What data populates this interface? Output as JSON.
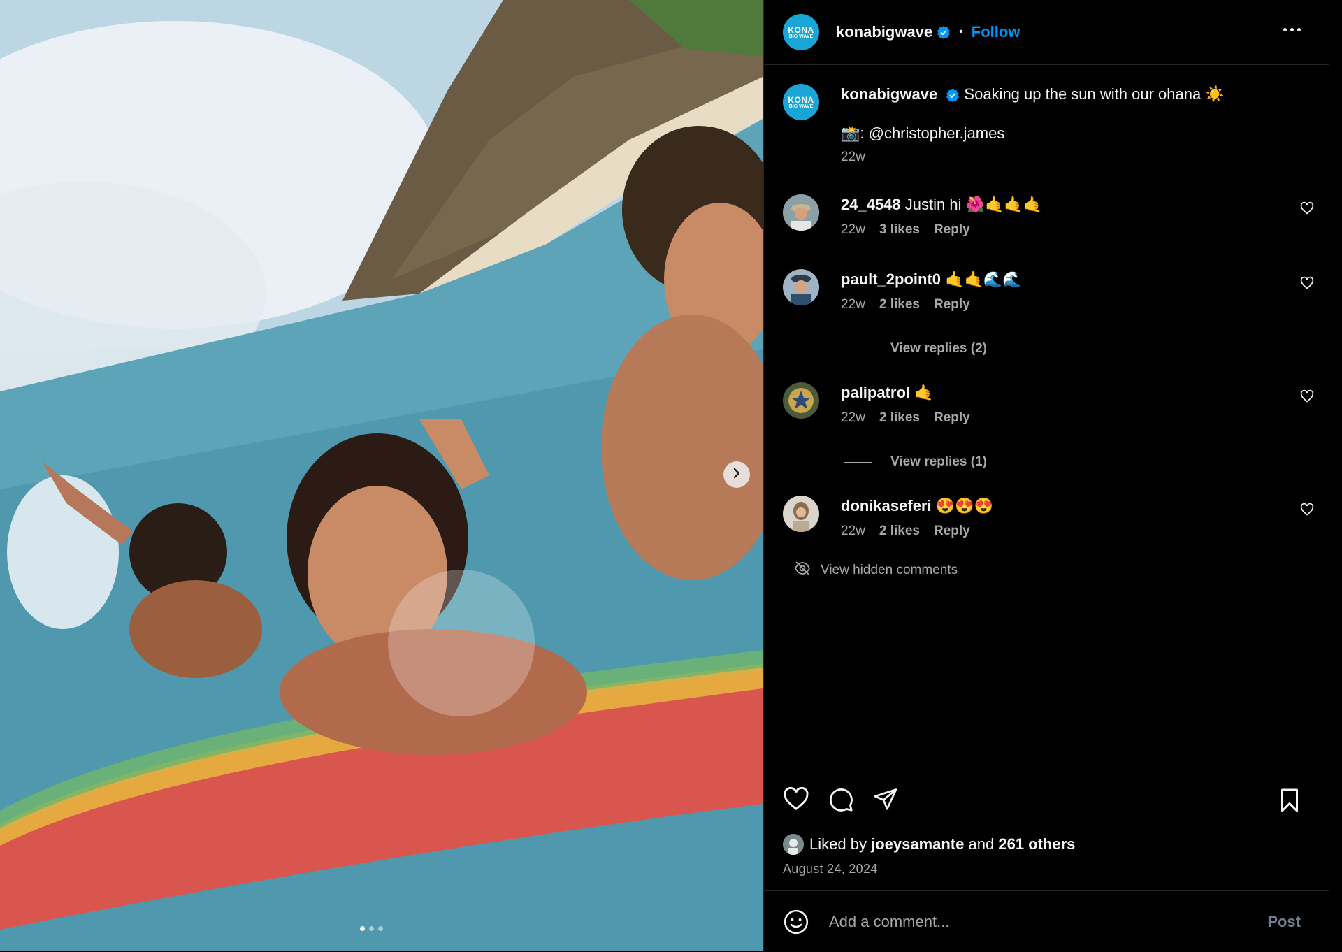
{
  "post": {
    "image_alt": "Friends swimming on a rainbow surfboard near a beach with mountains",
    "carousel_dots": 3,
    "active_dot": 0,
    "next_icon": "chevron-right-icon"
  },
  "header": {
    "logo_line1": "KONA",
    "logo_line2": "BIG WAVE",
    "username": "konabigwave",
    "separator": "•",
    "follow_label": "Follow",
    "more_icon": "more-horizontal-icon"
  },
  "caption": {
    "username": "konabigwave",
    "text": "Soaking up the sun with our ohana ☀️",
    "credit": "📸: @christopher.james",
    "time": "22w"
  },
  "comments": [
    {
      "username": "24_4548",
      "text": "Justin hi 🌺🤙🤙🤙",
      "time": "22w",
      "likes": "3 likes",
      "reply": "Reply"
    },
    {
      "username": "pault_2point0",
      "text": "🤙🤙🌊🌊",
      "time": "22w",
      "likes": "2 likes",
      "reply": "Reply",
      "view_replies": "View replies (2)"
    },
    {
      "username": "palipatrol",
      "text": "🤙",
      "time": "22w",
      "likes": "2 likes",
      "reply": "Reply",
      "view_replies": "View replies (1)"
    },
    {
      "username": "donikaseferi",
      "text": "😍😍😍",
      "time": "22w",
      "likes": "2 likes",
      "reply": "Reply"
    }
  ],
  "hidden_comments_label": "View hidden comments",
  "actions": {
    "icons": [
      "heart-icon",
      "comment-icon",
      "share-icon",
      "bookmark-icon"
    ]
  },
  "likes": {
    "prefix": "Liked by",
    "user": "joeysamante",
    "middle": "and",
    "others": "261 others"
  },
  "date": "August 24, 2024",
  "add_comment": {
    "placeholder": "Add a comment...",
    "post_label": "Post"
  },
  "colors": {
    "accent": "#0095f6",
    "background": "#000000",
    "secondary_text": "#a8a8a8",
    "logo_bg": "#19a6d6"
  }
}
